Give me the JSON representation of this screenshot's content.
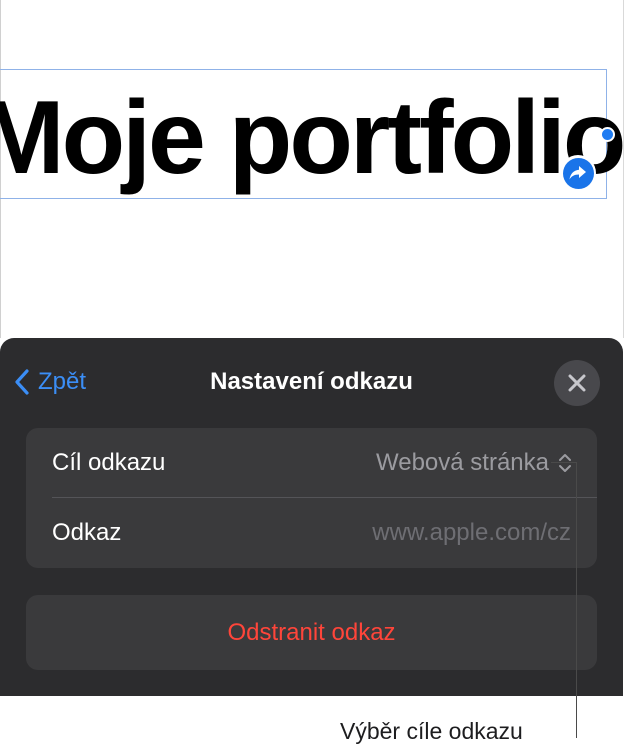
{
  "document": {
    "title_text": "Moje portfolio"
  },
  "link_panel": {
    "back_label": "Zpět",
    "title": "Nastavení odkazu",
    "link_target_label": "Cíl odkazu",
    "link_target_value": "Webová stránka",
    "link_label": "Odkaz",
    "link_placeholder": "www.apple.com/cz",
    "remove_link_label": "Odstranit odkaz"
  },
  "callout": {
    "text": "Výběr cíle odkazu"
  },
  "colors": {
    "accent": "#3b8ef6",
    "panel_bg": "#2c2c2e",
    "group_bg": "#3a3a3c",
    "destructive": "#ff453a",
    "selection_border": "#8fb2e8"
  },
  "icons": {
    "back": "chevron-left-icon",
    "close": "close-icon",
    "value_picker": "chevron-up-down-icon",
    "link_badge": "link-arrow-icon"
  }
}
